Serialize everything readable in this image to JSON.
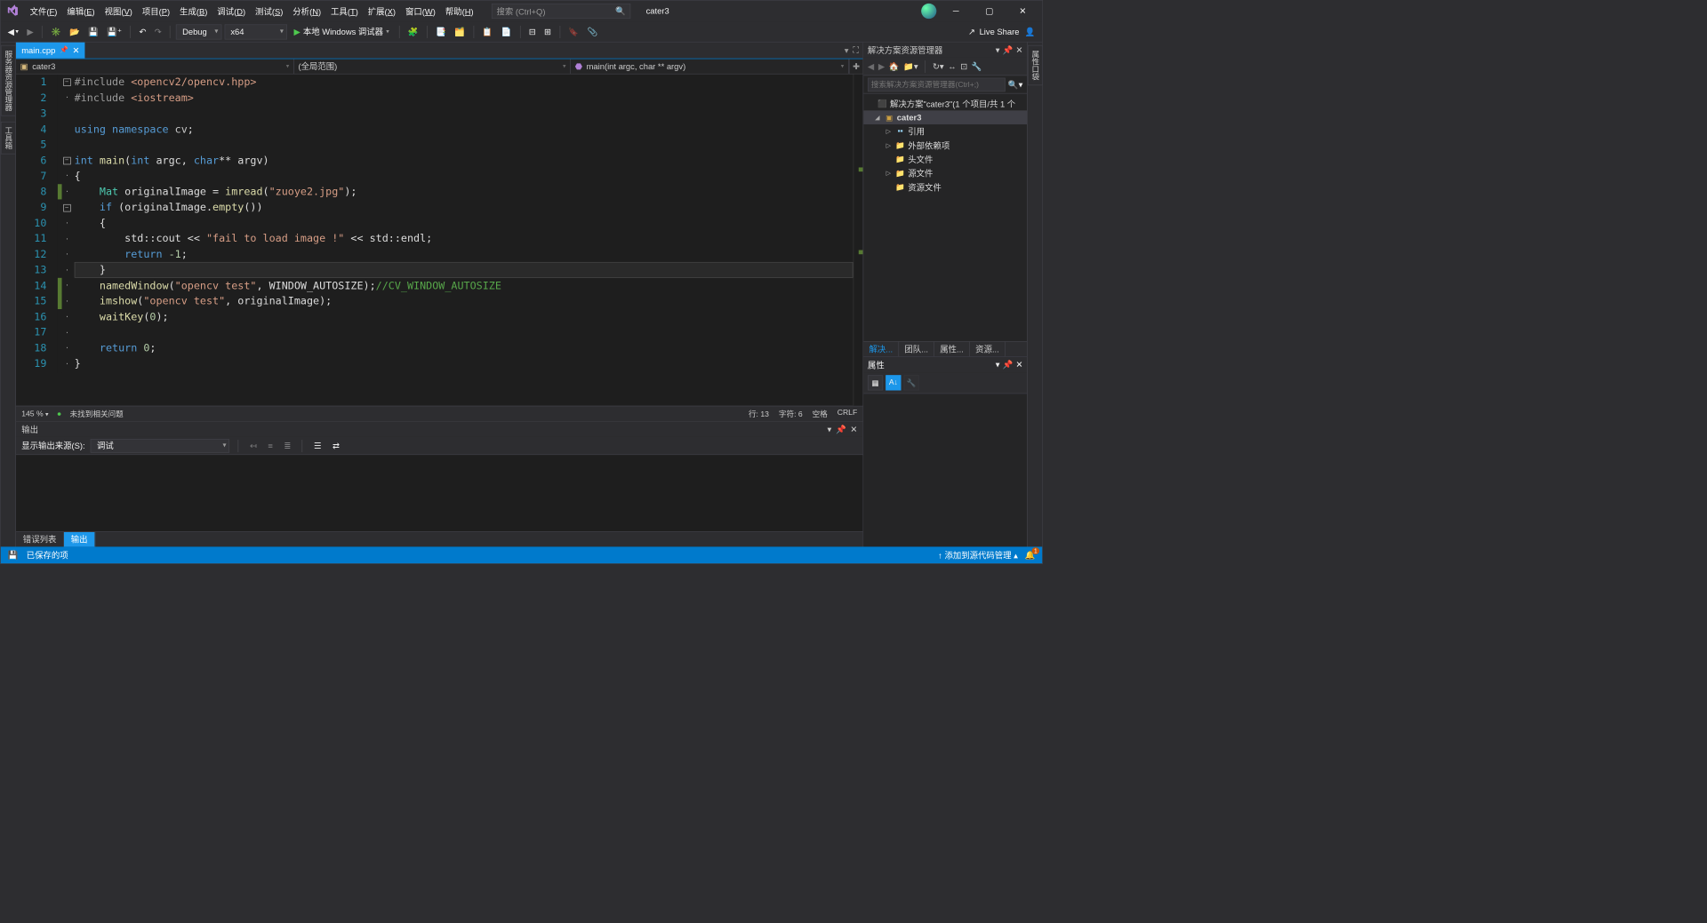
{
  "menu": {
    "items": [
      {
        "label": "文件",
        "key": "F"
      },
      {
        "label": "编辑",
        "key": "E"
      },
      {
        "label": "视图",
        "key": "V"
      },
      {
        "label": "项目",
        "key": "P"
      },
      {
        "label": "生成",
        "key": "B"
      },
      {
        "label": "调试",
        "key": "D"
      },
      {
        "label": "测试",
        "key": "S"
      },
      {
        "label": "分析",
        "key": "N"
      },
      {
        "label": "工具",
        "key": "T"
      },
      {
        "label": "扩展",
        "key": "X"
      },
      {
        "label": "窗口",
        "key": "W"
      },
      {
        "label": "帮助",
        "key": "H"
      }
    ]
  },
  "search_placeholder": "搜索 (Ctrl+Q)",
  "user_label": "cater3",
  "toolbar": {
    "config": "Debug",
    "platform": "x64",
    "run": "本地 Windows 调试器",
    "liveshare": "Live Share"
  },
  "left_rails": [
    "服务器资源管理器",
    "工具箱"
  ],
  "right_rails": [
    "属性口袋"
  ],
  "doctab": {
    "name": "main.cpp"
  },
  "nav": {
    "scope1": "cater3",
    "scope2": "(全局范围)",
    "scope3": "main(int argc, char ** argv)"
  },
  "code_lines": [
    {
      "n": 1,
      "fold": "box-",
      "change": "",
      "html": "<span class='tk-pp'>#include</span> <span class='tk-inc'>&lt;opencv2/opencv.hpp&gt;</span>"
    },
    {
      "n": 2,
      "fold": "bar",
      "change": "",
      "html": "<span class='tk-pp'>#include</span> <span class='tk-inc'>&lt;iostream&gt;</span>"
    },
    {
      "n": 3,
      "fold": "",
      "change": "",
      "html": ""
    },
    {
      "n": 4,
      "fold": "",
      "change": "",
      "html": "<span class='tk-kw'>using</span> <span class='tk-kw'>namespace</span> <span class='tk-ns'>cv</span>;"
    },
    {
      "n": 5,
      "fold": "",
      "change": "",
      "html": ""
    },
    {
      "n": 6,
      "fold": "box-",
      "change": "",
      "html": "<span class='tk-kw'>int</span> <span class='tk-fn'>main</span>(<span class='tk-kw'>int</span> argc, <span class='tk-kw'>char</span>** argv)"
    },
    {
      "n": 7,
      "fold": "bar",
      "change": "",
      "html": "{"
    },
    {
      "n": 8,
      "fold": "bar",
      "change": "g",
      "html": "    <span class='tk-cls'>Mat</span> originalImage = <span class='tk-fn'>imread</span>(<span class='tk-str'>\"zuoye2.jpg\"</span>);"
    },
    {
      "n": 9,
      "fold": "box-",
      "change": "",
      "html": "    <span class='tk-kw'>if</span> (originalImage.<span class='tk-fn'>empty</span>())"
    },
    {
      "n": 10,
      "fold": "bar",
      "change": "",
      "html": "    {"
    },
    {
      "n": 11,
      "fold": "bar",
      "change": "",
      "html": "        std::cout &lt;&lt; <span class='tk-str'>\"fail to load image !\"</span> &lt;&lt; std::endl;"
    },
    {
      "n": 12,
      "fold": "bar",
      "change": "",
      "html": "        <span class='tk-kw'>return</span> <span class='tk-num'>-1</span>;"
    },
    {
      "n": 13,
      "fold": "bar",
      "change": "",
      "html": "    }",
      "current": true
    },
    {
      "n": 14,
      "fold": "bar",
      "change": "g",
      "html": "    <span class='tk-fn'>namedWindow</span>(<span class='tk-str'>\"opencv test\"</span>, WINDOW_AUTOSIZE);<span class='tk-cmt'>//CV_WINDOW_AUTOSIZE</span>"
    },
    {
      "n": 15,
      "fold": "bar",
      "change": "g",
      "html": "    <span class='tk-fn'>imshow</span>(<span class='tk-str'>\"opencv test\"</span>, originalImage);"
    },
    {
      "n": 16,
      "fold": "bar",
      "change": "",
      "html": "    <span class='tk-fn'>waitKey</span>(<span class='tk-num'>0</span>);"
    },
    {
      "n": 17,
      "fold": "bar",
      "change": "",
      "html": ""
    },
    {
      "n": 18,
      "fold": "bar",
      "change": "",
      "html": "    <span class='tk-kw'>return</span> <span class='tk-num'>0</span>;"
    },
    {
      "n": 19,
      "fold": "bar",
      "change": "",
      "html": "}"
    }
  ],
  "ed_status": {
    "zoom": "145 %",
    "issues": "未找到相关问题",
    "line": "行: 13",
    "col": "字符: 6",
    "ins": "空格",
    "eol": "CRLF"
  },
  "output": {
    "title": "输出",
    "src_label": "显示输出来源(S):",
    "src_value": "调试"
  },
  "bottom_tabs": {
    "errlist": "错误列表",
    "output": "输出"
  },
  "sle": {
    "title": "解决方案资源管理器",
    "search_placeholder": "搜索解决方案资源管理器(Ctrl+;)",
    "solution": "解决方案\"cater3\"(1 个项目/共 1 个",
    "project": "cater3",
    "nodes": {
      "refs": "引用",
      "ext": "外部依赖项",
      "hdr": "头文件",
      "src": "源文件",
      "res": "资源文件"
    }
  },
  "sle_tabs": {
    "sle": "解决...",
    "team": "团队...",
    "prop": "属性...",
    "res": "资源..."
  },
  "prop": {
    "title": "属性"
  },
  "statusbar": {
    "saved": "已保存的项",
    "source_ctrl": "添加到源代码管理",
    "notif_count": "1"
  }
}
